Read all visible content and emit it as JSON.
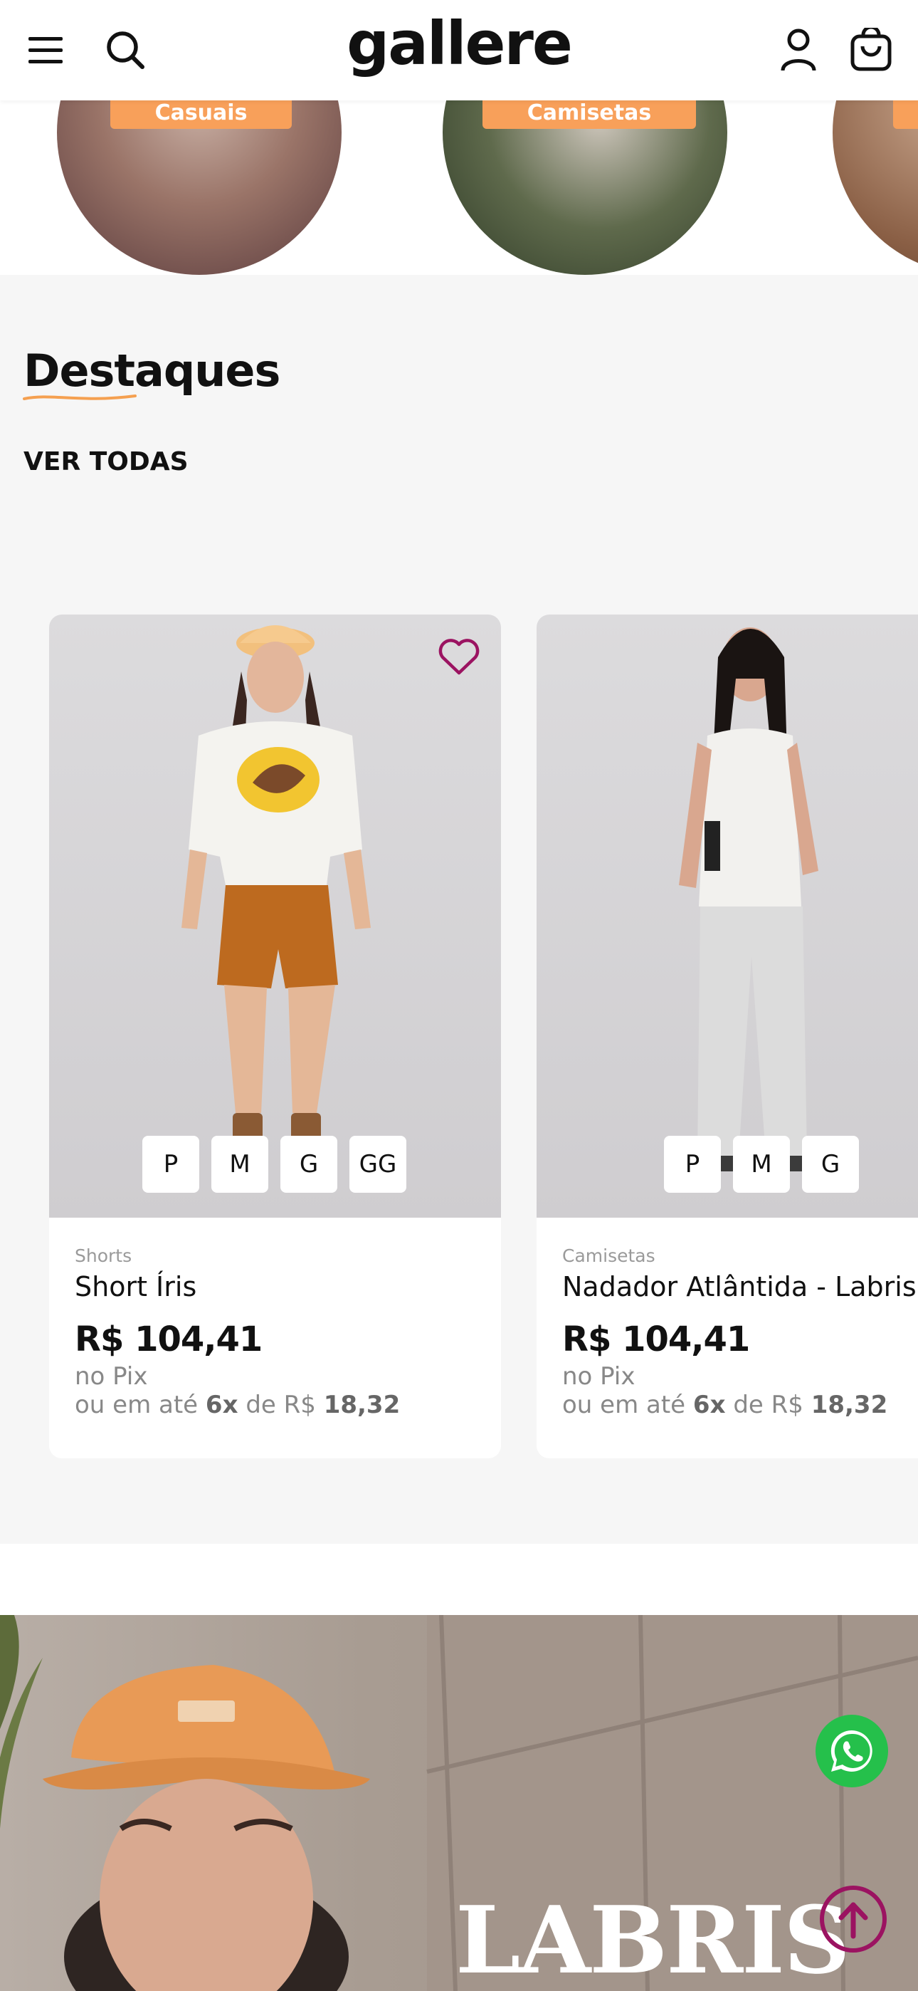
{
  "header": {
    "logo": "gallere",
    "menu_icon": "hamburger-menu-icon",
    "search_icon": "search-icon",
    "account_icon": "user-icon",
    "cart_icon": "shopping-bag-icon"
  },
  "categories": [
    {
      "label": "Casuais"
    },
    {
      "label": "Camisetas"
    }
  ],
  "featured": {
    "title": "Destaques",
    "see_all": "VER TODAS",
    "accent_color": "#f5a050",
    "products": [
      {
        "category": "Shorts",
        "name": "Short Íris",
        "price": "R$ 104,41",
        "pix_note": "no Pix",
        "installment_prefix": "ou em até",
        "installment_count": "6x",
        "installment_mid": "de R$",
        "installment_value": "18,32",
        "sizes": [
          "P",
          "M",
          "G",
          "GG"
        ]
      },
      {
        "category": "Camisetas",
        "name": "Nadador Atlântida - Labris",
        "price": "R$ 104,41",
        "pix_note": "no Pix",
        "installment_prefix": "ou em até",
        "installment_count": "6x",
        "installment_mid": "de R$",
        "installment_value": "18,32",
        "sizes": [
          "P",
          "M",
          "G"
        ]
      }
    ]
  },
  "banner": {
    "brand": "LABRIS"
  },
  "floating": {
    "whatsapp_icon": "whatsapp-icon",
    "back_to_top_icon": "arrow-up-icon",
    "whatsapp_color": "#25c04b",
    "back_to_top_color": "#9b1361"
  }
}
